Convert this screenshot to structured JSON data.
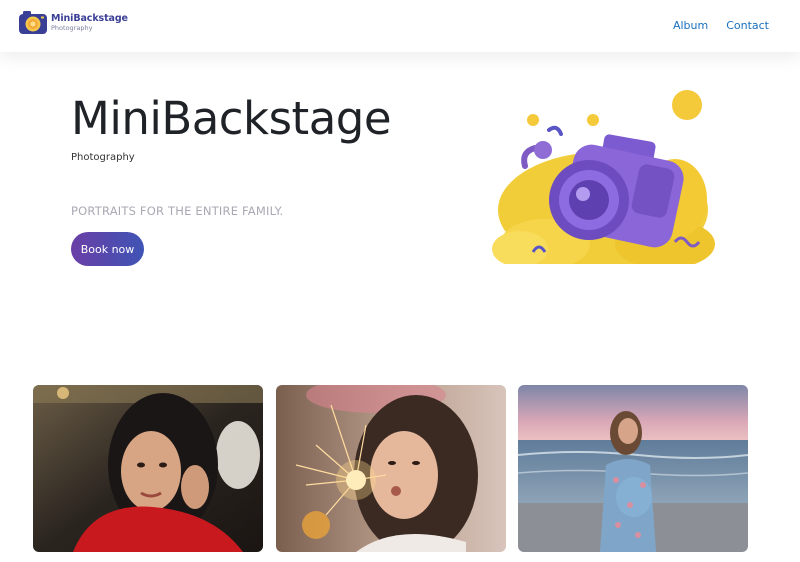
{
  "header": {
    "brand_name": "MiniBackstage",
    "brand_tagline": "Photography",
    "nav": [
      {
        "label": "Album"
      },
      {
        "label": "Contact"
      }
    ]
  },
  "hero": {
    "title": "MiniBackstage",
    "subtitle": "Photography",
    "tagline": "PORTRAITS FOR THE ENTIRE FAMILY.",
    "cta_label": "Book now",
    "illustration": "camera-illustration"
  },
  "gallery": [
    {
      "image": "portrait-woman-red-top"
    },
    {
      "image": "girl-with-sparkler"
    },
    {
      "image": "pregnant-woman-beach"
    }
  ],
  "colors": {
    "brand": "#3a3f96",
    "nav_link": "#1a6fbd",
    "button_start": "#6a3fa6",
    "button_end": "#3f54b5",
    "tagline": "#a9a9b3"
  }
}
